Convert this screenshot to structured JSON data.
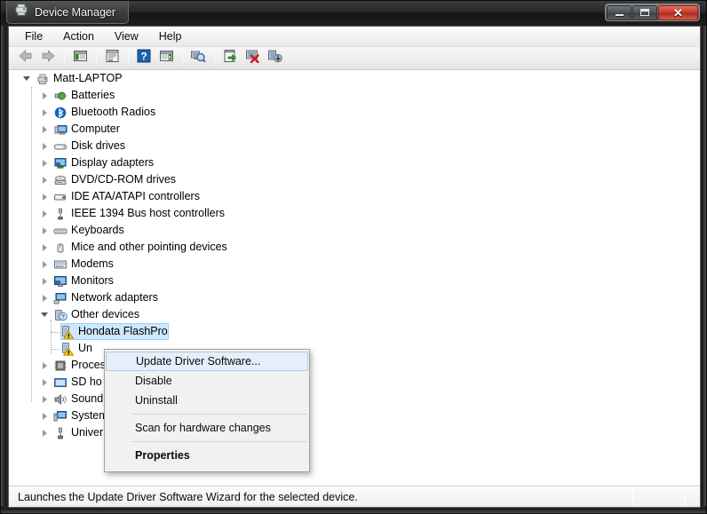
{
  "window": {
    "title": "Device Manager",
    "icon": "device-manager-icon",
    "buttons": {
      "minimize": "Minimize",
      "maximize": "Maximize",
      "close": "Close"
    }
  },
  "menubar": {
    "items": [
      {
        "label": "File",
        "name": "menu-file"
      },
      {
        "label": "Action",
        "name": "menu-action"
      },
      {
        "label": "View",
        "name": "menu-view"
      },
      {
        "label": "Help",
        "name": "menu-help"
      }
    ]
  },
  "toolbar": {
    "buttons": [
      {
        "name": "back-button",
        "icon": "back-arrow-icon",
        "label": "Back"
      },
      {
        "name": "forward-button",
        "icon": "forward-arrow-icon",
        "label": "Forward"
      },
      {
        "name": "show-hide-console-tree-button",
        "icon": "console-tree-icon",
        "label": "Show/Hide Console Tree"
      },
      {
        "name": "properties-button",
        "icon": "properties-icon",
        "label": "Properties"
      },
      {
        "name": "help-button",
        "icon": "question-mark-icon",
        "label": "Help"
      },
      {
        "name": "show-hide-action-pane-button",
        "icon": "action-pane-icon",
        "label": "Show/Hide Action Pane"
      },
      {
        "name": "scan-hardware-changes-button",
        "icon": "scan-magnifier-icon",
        "label": "Scan for hardware changes"
      },
      {
        "name": "update-driver-button",
        "icon": "update-driver-icon",
        "label": "Update Driver Software"
      },
      {
        "name": "uninstall-button",
        "icon": "uninstall-red-x-icon",
        "label": "Uninstall"
      },
      {
        "name": "disable-button",
        "icon": "disable-device-icon",
        "label": "Disable"
      }
    ]
  },
  "tree": {
    "root": {
      "label": "Matt-LAPTOP",
      "icon": "computer-root-icon",
      "expanded": true
    },
    "items": [
      {
        "label": "Batteries",
        "icon": "battery-icon",
        "indent": 1,
        "expandable": true
      },
      {
        "label": "Bluetooth Radios",
        "icon": "bluetooth-icon",
        "indent": 1,
        "expandable": true
      },
      {
        "label": "Computer",
        "icon": "computer-icon",
        "indent": 1,
        "expandable": true
      },
      {
        "label": "Disk drives",
        "icon": "disk-drive-icon",
        "indent": 1,
        "expandable": true
      },
      {
        "label": "Display adapters",
        "icon": "display-adapter-icon",
        "indent": 1,
        "expandable": true
      },
      {
        "label": "DVD/CD-ROM drives",
        "icon": "dvd-drive-icon",
        "indent": 1,
        "expandable": true
      },
      {
        "label": "IDE ATA/ATAPI controllers",
        "icon": "ide-controller-icon",
        "indent": 1,
        "expandable": true
      },
      {
        "label": "IEEE 1394 Bus host controllers",
        "icon": "ieee1394-icon",
        "indent": 1,
        "expandable": true
      },
      {
        "label": "Keyboards",
        "icon": "keyboard-icon",
        "indent": 1,
        "expandable": true
      },
      {
        "label": "Mice and other pointing devices",
        "icon": "mouse-icon",
        "indent": 1,
        "expandable": true
      },
      {
        "label": "Modems",
        "icon": "modem-icon",
        "indent": 1,
        "expandable": true
      },
      {
        "label": "Monitors",
        "icon": "monitor-icon",
        "indent": 1,
        "expandable": true
      },
      {
        "label": "Network adapters",
        "icon": "network-adapter-icon",
        "indent": 1,
        "expandable": true
      },
      {
        "label": "Other devices",
        "icon": "other-devices-icon",
        "indent": 1,
        "expandable": true,
        "expanded": true
      },
      {
        "label": "Hondata FlashPro",
        "icon": "unknown-device-warning-icon",
        "indent": 2,
        "expandable": false,
        "selected": true,
        "warning": true
      },
      {
        "label": "Un",
        "icon": "unknown-device-warning-icon",
        "indent": 2,
        "expandable": false,
        "warning": true,
        "truncated": true
      },
      {
        "label": "Proces",
        "icon": "processor-icon",
        "indent": 1,
        "expandable": true,
        "truncated": true
      },
      {
        "label": "SD ho",
        "icon": "sd-host-adapter-icon",
        "indent": 1,
        "expandable": true,
        "truncated": true
      },
      {
        "label": "Sound",
        "icon": "sound-icon",
        "indent": 1,
        "expandable": true,
        "truncated": true
      },
      {
        "label": "System",
        "icon": "system-devices-icon",
        "indent": 1,
        "expandable": true,
        "truncated": true
      },
      {
        "label": "Univer",
        "icon": "usb-controller-icon",
        "indent": 1,
        "expandable": true,
        "truncated": true
      }
    ]
  },
  "context_menu": {
    "items": [
      {
        "label": "Update Driver Software...",
        "name": "ctx-update-driver-software",
        "highlighted": true,
        "bold": false
      },
      {
        "label": "Disable",
        "name": "ctx-disable",
        "highlighted": false,
        "bold": false
      },
      {
        "label": "Uninstall",
        "name": "ctx-uninstall",
        "highlighted": false,
        "bold": false
      },
      {
        "label": "Scan for hardware changes",
        "name": "ctx-scan-for-hardware-changes",
        "highlighted": false,
        "bold": false
      },
      {
        "label": "Properties",
        "name": "ctx-properties",
        "highlighted": false,
        "bold": true
      }
    ]
  },
  "statusbar": {
    "text": "Launches the Update Driver Software Wizard for the selected device."
  },
  "colors": {
    "selection_fill": "#cce8ff",
    "selection_border": "#99d1ff",
    "menu_highlight": "#e4effa",
    "warning_yellow": "#ffcc00",
    "close_button_red": "#c93a2c"
  }
}
